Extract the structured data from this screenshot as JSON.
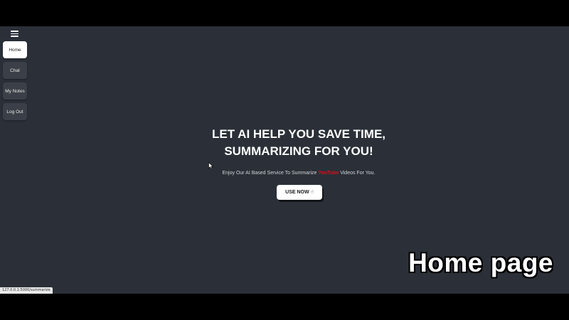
{
  "sidebar": {
    "items": [
      {
        "label": "Home",
        "active": true
      },
      {
        "label": "Chat",
        "active": false
      },
      {
        "label": "My Notes",
        "active": false
      },
      {
        "label": "Log Out",
        "active": false
      }
    ]
  },
  "hero": {
    "title_line1": "LET AI HELP YOU SAVE TIME,",
    "title_line2": "SUMMARIZING FOR YOU!",
    "subtitle_before": "Enjoy Our AI Based Service To Summarize ",
    "subtitle_brand": "YouTube",
    "subtitle_after": " Videos For You.",
    "cta_label": "USE NOW"
  },
  "overlay": {
    "caption": "Home page"
  },
  "status_bar": {
    "url": "127.0.0.1:5000/summarize"
  },
  "colors": {
    "page_background": "#2b3038",
    "brand_red": "#e00b1c",
    "button_active": "#ffffff",
    "button_inactive": "#3b4048"
  },
  "icons": {
    "menu": "hamburger-menu-icon",
    "cta": "pointing-hand-icon"
  }
}
